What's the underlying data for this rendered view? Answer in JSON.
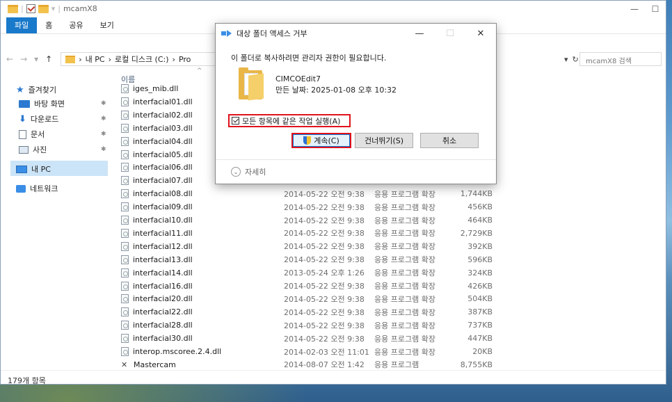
{
  "window": {
    "title": "mcamX8",
    "minimize": "—",
    "maximize": "☐"
  },
  "ribbon": {
    "tabs": [
      "파일",
      "홈",
      "공유",
      "보기"
    ]
  },
  "address": {
    "path": [
      "내 PC",
      "로컬 디스크 (C:)",
      "Pro"
    ],
    "search_placeholder": "mcamX8 검색"
  },
  "nav": {
    "quick_access": "즐겨찾기",
    "desktop": "바탕 화면",
    "downloads": "다운로드",
    "documents": "문서",
    "pictures": "사진",
    "this_pc": "내 PC",
    "network": "네트워크"
  },
  "columns": {
    "name": "이름"
  },
  "files": [
    {
      "name": "iges_mib.dll",
      "date": "",
      "type": "",
      "size": ""
    },
    {
      "name": "interfacial01.dll",
      "date": "",
      "type": "",
      "size": ""
    },
    {
      "name": "interfacial02.dll",
      "date": "",
      "type": "",
      "size": ""
    },
    {
      "name": "interfacial03.dll",
      "date": "",
      "type": "",
      "size": ""
    },
    {
      "name": "interfacial04.dll",
      "date": "",
      "type": "",
      "size": ""
    },
    {
      "name": "interfacial05.dll",
      "date": "",
      "type": "",
      "size": ""
    },
    {
      "name": "interfacial06.dll",
      "date": "",
      "type": "",
      "size": ""
    },
    {
      "name": "interfacial07.dll",
      "date": "",
      "type": "",
      "size": ""
    },
    {
      "name": "interfacial08.dll",
      "date": "2014-05-22 오전 9:38",
      "type": "응용 프로그램 확장",
      "size": "1,744KB"
    },
    {
      "name": "interfacial09.dll",
      "date": "2014-05-22 오전 9:38",
      "type": "응용 프로그램 확장",
      "size": "456KB"
    },
    {
      "name": "interfacial10.dll",
      "date": "2014-05-22 오전 9:38",
      "type": "응용 프로그램 확장",
      "size": "464KB"
    },
    {
      "name": "interfacial11.dll",
      "date": "2014-05-22 오전 9:38",
      "type": "응용 프로그램 확장",
      "size": "2,729KB"
    },
    {
      "name": "interfacial12.dll",
      "date": "2014-05-22 오전 9:38",
      "type": "응용 프로그램 확장",
      "size": "392KB"
    },
    {
      "name": "interfacial13.dll",
      "date": "2014-05-22 오전 9:38",
      "type": "응용 프로그램 확장",
      "size": "596KB"
    },
    {
      "name": "interfacial14.dll",
      "date": "2013-05-24 오후 1:26",
      "type": "응용 프로그램 확장",
      "size": "324KB"
    },
    {
      "name": "interfacial16.dll",
      "date": "2014-05-22 오전 9:38",
      "type": "응용 프로그램 확장",
      "size": "426KB"
    },
    {
      "name": "interfacial20.dll",
      "date": "2014-05-22 오전 9:38",
      "type": "응용 프로그램 확장",
      "size": "504KB"
    },
    {
      "name": "interfacial22.dll",
      "date": "2014-05-22 오전 9:38",
      "type": "응용 프로그램 확장",
      "size": "387KB"
    },
    {
      "name": "interfacial28.dll",
      "date": "2014-05-22 오전 9:38",
      "type": "응용 프로그램 확장",
      "size": "737KB"
    },
    {
      "name": "interfacial30.dll",
      "date": "2014-05-22 오전 9:38",
      "type": "응용 프로그램 확장",
      "size": "447KB"
    },
    {
      "name": "interop.mscoree.2.4.dll",
      "date": "2014-02-03 오전 11:01",
      "type": "응용 프로그램 확장",
      "size": "20KB"
    },
    {
      "name": "Mastercam",
      "date": "2014-08-07 오전 1:42",
      "type": "응용 프로그램",
      "size": "8,755KB"
    }
  ],
  "status": {
    "count": "179개 항목"
  },
  "dialog": {
    "title": "대상 폴더 액세스 거부",
    "close": "✕",
    "minimize": "—",
    "maximize": "☐",
    "message": "이 폴더로 복사하려면 관리자 권한이 필요합니다.",
    "item_name": "CIMCOEdit7",
    "item_meta": "만든 날짜: 2025-01-08 오후 10:32",
    "do_for_all": "모든 항목에 같은 작업 실행(A)",
    "continue": "계속(C)",
    "skip": "건너뛰기(S)",
    "cancel": "취소",
    "details": "자세히"
  }
}
